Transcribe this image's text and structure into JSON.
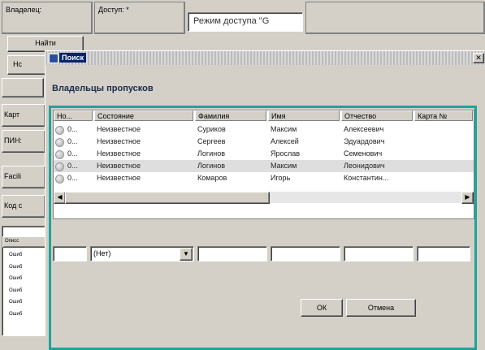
{
  "form": {
    "owner_label": "Владелец:",
    "access_label": "Доступ: *",
    "access_mode_value": "Режим доступа \"G",
    "find_label": "Найти",
    "ho_label": "Нс",
    "card_label": "Карт",
    "pin_label": "ПИН:",
    "facility_label": "Facili",
    "code_label": "Код с",
    "log_header": "Описс",
    "log_items": [
      "Ошиб",
      "Ошиб",
      "Ошиб",
      "Ошиб",
      "Ошиб",
      "Ошиб"
    ]
  },
  "dialog": {
    "title": "Поиск",
    "heading": "Владельцы пропусков",
    "columns": [
      "Но...",
      "Состояние",
      "Фамилия",
      "Имя",
      "Отчество",
      "Карта №"
    ],
    "rows": [
      {
        "num": "0...",
        "state": "Неизвестное",
        "last": "Суриков",
        "first": "Максим",
        "middle": "Алексеевич"
      },
      {
        "num": "0...",
        "state": "Неизвестное",
        "last": "Сергеев",
        "first": "Алексей",
        "middle": "Эдуардович"
      },
      {
        "num": "0...",
        "state": "Неизвестное",
        "last": "Логинов",
        "first": "Ярослав",
        "middle": "Семенович"
      },
      {
        "num": "0...",
        "state": "Неизвестное",
        "last": "Логинов",
        "first": "Максим",
        "middle": "Леонидович"
      },
      {
        "num": "0...",
        "state": "Неизвестное",
        "last": "Комаров",
        "first": "Игорь",
        "middle": "Константин..."
      }
    ],
    "filter_state_value": "(Нет)",
    "ok_label": "ОК",
    "cancel_label": "Отмена"
  }
}
